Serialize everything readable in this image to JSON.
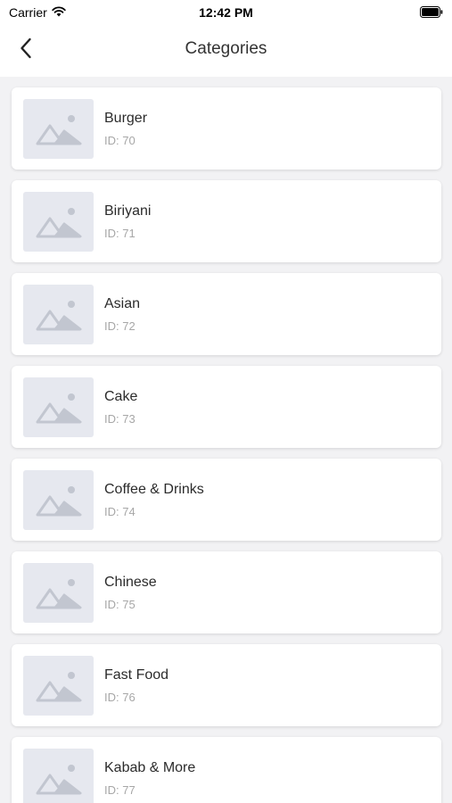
{
  "status_bar": {
    "carrier": "Carrier",
    "time": "12:42 PM",
    "icons": [
      "wifi-icon",
      "battery-icon"
    ]
  },
  "header": {
    "back_icon": "chevron-left-icon",
    "title": "Categories"
  },
  "categories": [
    {
      "name": "Burger",
      "id": "ID: 70",
      "image_icon": "image-placeholder-icon"
    },
    {
      "name": "Biriyani",
      "id": "ID: 71",
      "image_icon": "image-placeholder-icon"
    },
    {
      "name": "Asian",
      "id": "ID: 72",
      "image_icon": "image-placeholder-icon"
    },
    {
      "name": "Cake",
      "id": "ID: 73",
      "image_icon": "image-placeholder-icon"
    },
    {
      "name": "Coffee & Drinks",
      "id": "ID: 74",
      "image_icon": "image-placeholder-icon"
    },
    {
      "name": "Chinese",
      "id": "ID: 75",
      "image_icon": "image-placeholder-icon"
    },
    {
      "name": "Fast Food",
      "id": "ID: 76",
      "image_icon": "image-placeholder-icon"
    },
    {
      "name": "Kabab & More",
      "id": "ID: 77",
      "image_icon": "image-placeholder-icon"
    }
  ],
  "colors": {
    "background": "#f2f2f4",
    "card": "#ffffff",
    "placeholder": "#e6e8ef",
    "placeholder_glyph": "#c2c6d0",
    "title_text": "#2b2b2b",
    "id_text": "#a7a7a7"
  }
}
